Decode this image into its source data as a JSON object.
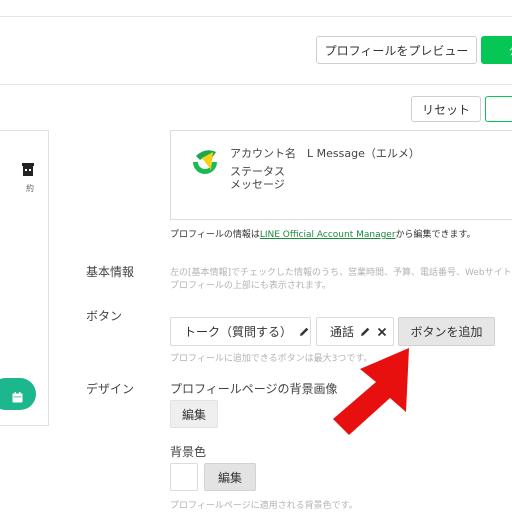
{
  "header": {
    "preview_button": "プロフィールをプレビュー",
    "save_button": "公"
  },
  "toolbar": {
    "reset_button": "リセット"
  },
  "sidebar": {
    "caption": "約"
  },
  "profile": {
    "account_name_label": "アカウント名",
    "account_name_value": "L Message（エルメ）",
    "status_message_label_1": "ステータス",
    "status_message_label_2": "メッセージ",
    "info_prefix": "プロフィールの情報は",
    "info_link": "LINE Official Account Manager",
    "info_suffix": "から編集できます。"
  },
  "basic_info": {
    "label": "基本情報",
    "desc_1": "左の[基本情報]でチェックした情報のうち、営業時間、予算、電話番号、Webサイト",
    "desc_2": "プロフィールの上部にも表示されます。"
  },
  "buttons_section": {
    "label": "ボタン",
    "talk_button": "トーク（質問する）",
    "call_button": "通話",
    "add_button": "ボタンを追加",
    "hint": "プロフィールに追加できるボタンは最大3つです。"
  },
  "design": {
    "label": "デザイン",
    "bg_image_title": "プロフィールページの背景画像",
    "edit_label": "編集",
    "bg_color_title": "背景色",
    "bg_color_edit": "編集",
    "bg_color_hint": "プロフィールページに適用される背景色です。"
  },
  "colors": {
    "brand_green": "#06c755",
    "arrow_red": "#e8100f"
  }
}
